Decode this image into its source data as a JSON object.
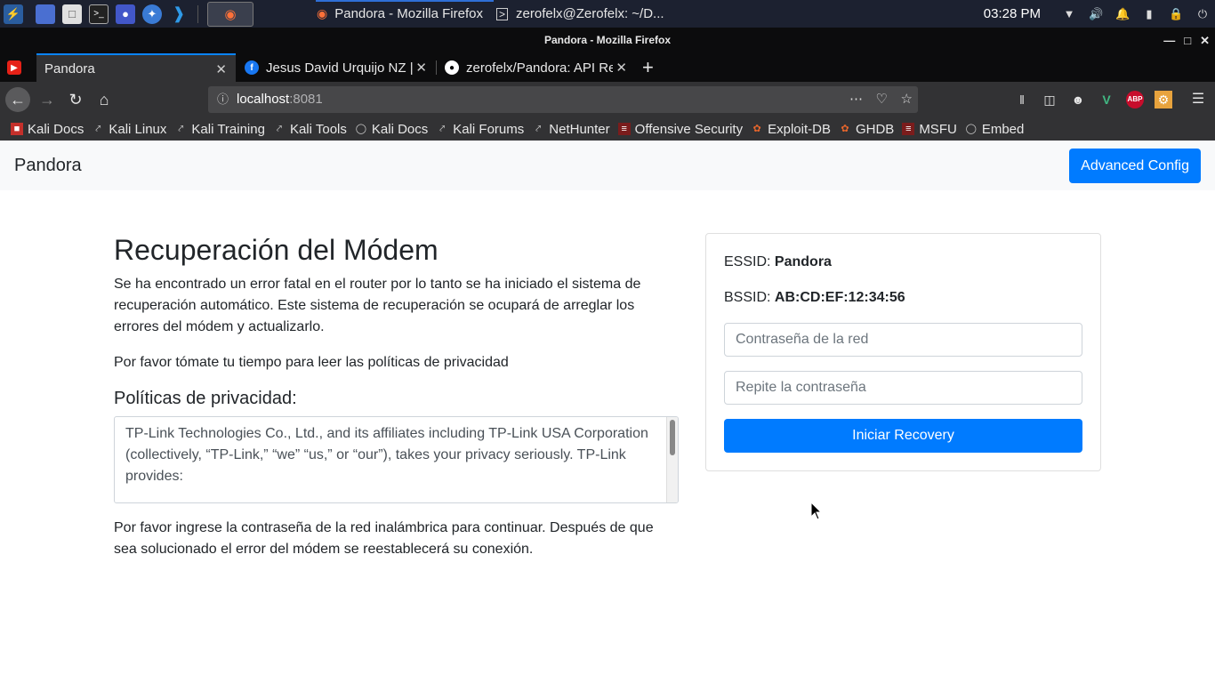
{
  "panel": {
    "tasks": [
      {
        "label": "Pandora - Mozilla Firefox"
      },
      {
        "label": "zerofelx@Zerofelx: ~/D..."
      }
    ],
    "clock": "03:28 PM"
  },
  "window": {
    "title": "Pandora - Mozilla Firefox"
  },
  "tabs": [
    {
      "label": "Pandora",
      "active": true
    },
    {
      "label": "Jesus David Urquijo NZ |",
      "active": false
    },
    {
      "label": "zerofelx/Pandora: API Re",
      "active": false
    }
  ],
  "navbar": {
    "url_host": "localhost",
    "url_port": ":8081"
  },
  "bookmarks": [
    {
      "label": "Kali Docs",
      "icon": "kali-docs-icon"
    },
    {
      "label": "Kali Linux",
      "icon": "kali-dragon-icon"
    },
    {
      "label": "Kali Training",
      "icon": "kali-dragon-icon"
    },
    {
      "label": "Kali Tools",
      "icon": "kali-dragon-icon"
    },
    {
      "label": "Kali Docs",
      "icon": "globe-icon"
    },
    {
      "label": "Kali Forums",
      "icon": "kali-dragon-icon"
    },
    {
      "label": "NetHunter",
      "icon": "kali-dragon-icon"
    },
    {
      "label": "Offensive Security",
      "icon": "offsec-icon"
    },
    {
      "label": "Exploit-DB",
      "icon": "exploitdb-icon"
    },
    {
      "label": "GHDB",
      "icon": "exploitdb-icon"
    },
    {
      "label": "MSFU",
      "icon": "offsec-icon"
    },
    {
      "label": "Embed",
      "icon": "globe-icon"
    }
  ],
  "page": {
    "brand": "Pandora",
    "advanced_button": "Advanced Config",
    "heading": "Recuperación del Módem",
    "intro": "Se ha encontrado un error fatal en el router por lo tanto se ha iniciado el sistema de recuperación automático. Este sistema de recuperación se ocupará de arreglar los errores del módem y actualizarlo.",
    "read_prompt": "Por favor tómate tu tiempo para leer las políticas de privacidad",
    "policy_heading": "Políticas de privacidad:",
    "policy_text": "TP-Link Technologies Co., Ltd., and its affiliates including TP-Link USA Corporation (collectively, “TP-Link,” “we” “us,” or “our”), takes your privacy seriously. TP-Link provides:",
    "outro": "Por favor ingrese la contraseña de la red inalámbrica para continuar. Después de que sea solucionado el error del módem se reestablecerá su conexión."
  },
  "form": {
    "essid_label": "ESSID:",
    "essid_value": "Pandora",
    "bssid_label": "BSSID:",
    "bssid_value": "AB:CD:EF:12:34:56",
    "password_placeholder": "Contraseña de la red",
    "repeat_placeholder": "Repite la contraseña",
    "submit_label": "Iniciar Recovery"
  },
  "colors": {
    "primary": "#007bff",
    "panel_bg": "#1c2130",
    "toolbar_bg": "#323234",
    "tab_accent": "#0a84ff"
  }
}
